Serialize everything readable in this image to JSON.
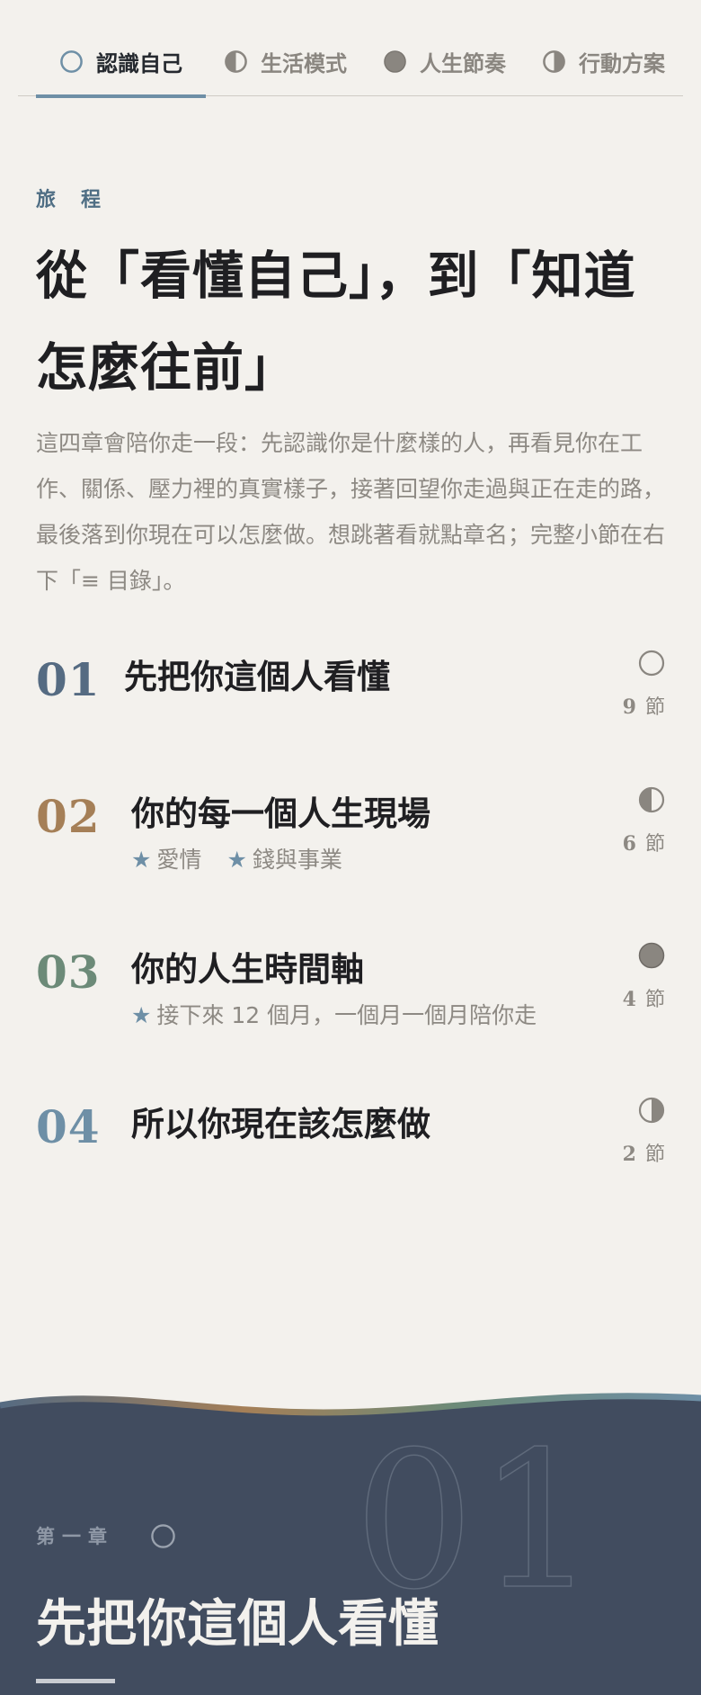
{
  "tabs": [
    {
      "label": "認識自己",
      "icon": "circle-outline-icon",
      "active": true
    },
    {
      "label": "生活模式",
      "icon": "half-circle-icon",
      "active": false
    },
    {
      "label": "人生節奏",
      "icon": "filled-circle-icon",
      "active": false
    },
    {
      "label": "行動方案",
      "icon": "half-circle-icon",
      "active": false
    }
  ],
  "intro": {
    "eyebrow": "旅程",
    "headline": "從「看懂自己」，到「知道怎麼往前」",
    "body": "這四章會陪你走一段：先認識你是什麼樣的人，再看見你在工作、關係、壓力裡的真實樣子，接著回望你走過與正在走的路，最後落到你現在可以怎麼做。想跳著看就點章名；完整小節在右下「≡ 目錄」。"
  },
  "chapters": [
    {
      "num": "01",
      "title": "先把你這個人看懂",
      "tags": [],
      "count": "9",
      "unit": "節",
      "icon": "circle-outline-icon",
      "color": "#556b82"
    },
    {
      "num": "02",
      "title": "你的每一個人生現場",
      "tags": [
        "愛情",
        "錢與事業"
      ],
      "count": "6",
      "unit": "節",
      "icon": "half-circle-icon",
      "color": "#a57f57"
    },
    {
      "num": "03",
      "title": "你的人生時間軸",
      "tags": [
        "接下來 12 個月，一個月一個月陪你走"
      ],
      "count": "4",
      "unit": "節",
      "icon": "filled-circle-icon",
      "color": "#6c8a78"
    },
    {
      "num": "04",
      "title": "所以你現在該怎麼做",
      "tags": [],
      "count": "2",
      "unit": "節",
      "icon": "half-circle-icon",
      "color": "#6e8fa6"
    }
  ],
  "tag_star": "★",
  "chapter_section": {
    "eyebrow": "第一章",
    "big_number": "01",
    "title": "先把你這個人看懂"
  },
  "colors": {
    "background": "#f3f1ed",
    "accent_blue": "#6e8fa6",
    "dark_section": "#414c5f",
    "muted_text": "#8d8983"
  }
}
